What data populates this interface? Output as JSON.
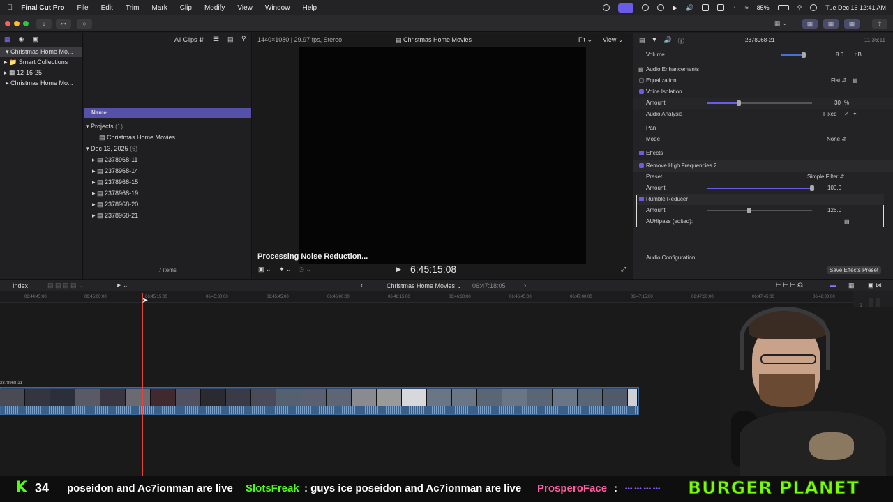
{
  "menubar": {
    "app_name": "Final Cut Pro",
    "items": [
      "File",
      "Edit",
      "Trim",
      "Mark",
      "Clip",
      "Modify",
      "View",
      "Window",
      "Help"
    ],
    "battery": "85%",
    "datetime": "Tue Dec 16  12:41 AM"
  },
  "libraries": {
    "rows": [
      "Christmas Home Mo...",
      "Smart Collections",
      "12-16-25",
      "Christmas Home Mo..."
    ]
  },
  "browser": {
    "filter": "All Clips",
    "column_name": "Name",
    "projects_label": "Projects",
    "projects_count": "(1)",
    "project_item": "Christmas Home Movies",
    "date_group": "Dec 13, 2025",
    "date_count": "(6)",
    "clips": [
      "2378968-11",
      "2378968-14",
      "2378968-15",
      "2378968-19",
      "2378968-20",
      "2378968-21"
    ],
    "items_count": "7 items"
  },
  "viewer": {
    "format": "1440×1080 | 29.97 fps, Stereo",
    "title": "Christmas Home Movies",
    "fit": "Fit",
    "view": "View",
    "processing": "Processing Noise Reduction...",
    "timecode": "6:45:15:08"
  },
  "inspector": {
    "clip_name": "2378968-21",
    "duration": "11:36:11",
    "volume_label": "Volume",
    "volume_value": "8.0",
    "volume_unit": "dB",
    "audio_enh": "Audio Enhancements",
    "equalization": "Equalization",
    "eq_value": "Flat",
    "voice_isolation": "Voice Isolation",
    "amount_label": "Amount",
    "vi_amount": "30",
    "vi_unit": "%",
    "audio_analysis": "Audio Analysis",
    "analysis_value": "Fixed",
    "pan": "Pan",
    "mode_label": "Mode",
    "mode_value": "None",
    "effects": "Effects",
    "effect1": "Remove High Frequencies 2",
    "preset_label": "Preset",
    "preset_value": "Simple Filter",
    "effect1_amount": "100.0",
    "effect2": "Rumble Reducer",
    "effect2_amount": "126.0",
    "auhipass": "AUHipass (edited):",
    "audio_config": "Audio Configuration",
    "save_preset": "Save Effects Preset",
    "levels": {
      "volume": 0.88,
      "voice_isolation": 0.3,
      "effect1_amount": 1.0,
      "effect2_amount": 0.4
    }
  },
  "timeline": {
    "index": "Index",
    "project": "Christmas Home Movies",
    "duration": "06:47:18:05",
    "ruler": [
      "06:44:45:00",
      "06:45:00:00",
      "06:45:15:00",
      "06:45:30:00",
      "06:45:45:00",
      "06:46:00:00",
      "06:46:15:00",
      "06:46:30:00",
      "06:46:45:00",
      "06:47:00:00",
      "06:47:15:00",
      "06:47:30:00",
      "06:47:45:00",
      "06:48:00:00"
    ],
    "clip_label": "2378968-21"
  },
  "meter_ticks": [
    "6",
    "0",
    "-6"
  ],
  "chat": {
    "counter": "34",
    "msg1": "poseidon and Ac7ionman are live",
    "user1": "SlotsFreak",
    "msg2": ": guys ice poseidon and Ac7ionman are live",
    "user2": "ProsperoFace",
    "msg3": ":",
    "banner": "BURGER PLANET"
  },
  "colors": {
    "accent": "#6b5ce7",
    "chat_green": "#53fc18",
    "banner": "#7cfc00"
  }
}
